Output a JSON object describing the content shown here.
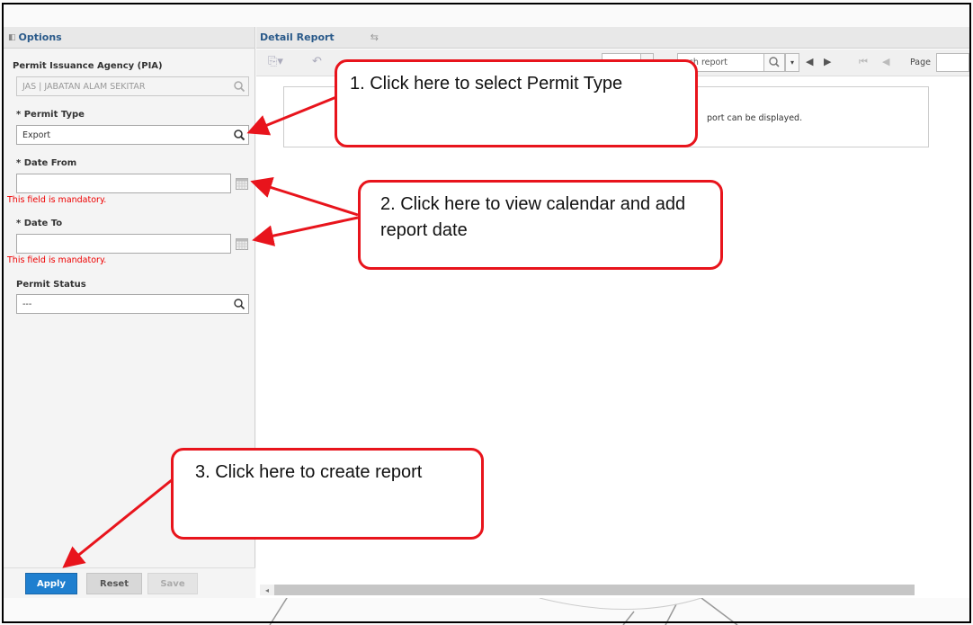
{
  "options": {
    "title": "Options",
    "toggle_icon": "collapse-icon",
    "pia_label": "Permit Issuance Agency (PIA)",
    "pia_value": "JAS | JABATAN ALAM SEKITAR",
    "permit_type_label": "* Permit Type",
    "permit_type_value": "Export",
    "date_from_label": "* Date From",
    "date_from_value": "",
    "date_from_error": "This field is mandatory.",
    "date_to_label": "* Date To",
    "date_to_value": "",
    "date_to_error": "This field is mandatory.",
    "permit_status_label": "Permit Status",
    "permit_status_value": "---",
    "buttons": {
      "apply": "Apply",
      "reset": "Reset",
      "save": "Save"
    }
  },
  "report": {
    "title": "Detail Report",
    "sync_icon": "sync-icon",
    "search_placeholder": "rch report",
    "page_label": "Page",
    "message": "port can be displayed."
  },
  "callouts": {
    "one": "1. Click here to select Permit Type",
    "two": "2. Click here to view calendar and add report date",
    "three": "3. Click here to create report"
  },
  "colors": {
    "callout_border": "#e8141c",
    "apply_bg": "#1f7fcf",
    "header_title": "#2a5a8a",
    "error": "#e00000"
  }
}
